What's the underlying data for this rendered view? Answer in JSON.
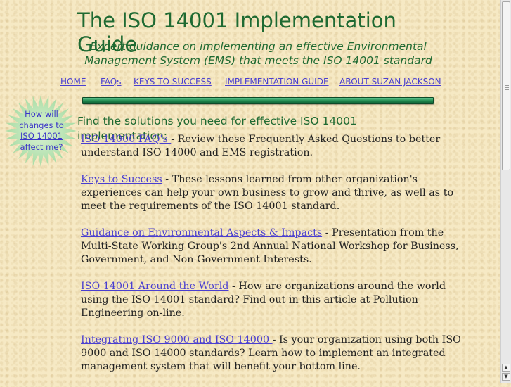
{
  "header": {
    "title": "The ISO 14001 Implementation Guide",
    "subtitle": "Expert guidance on implementing an effective Environmental Management System (EMS) that meets the ISO 14001 standard"
  },
  "nav": {
    "items": [
      {
        "label": "HOME"
      },
      {
        "label": "FAQs "
      },
      {
        "label": "KEYS TO SUCCESS"
      },
      {
        "label": "IMPLEMENTATION GUIDE"
      },
      {
        "label": "ABOUT SUZAN JACKSON"
      }
    ]
  },
  "starburst": {
    "link": "How will changes to ISO 14001 affect me?",
    "color": "#bde6b8"
  },
  "main": {
    "heading": "Find the solutions you need for effective ISO 14001 implementation:",
    "items": [
      {
        "link": "ISO 14000 FAQ's ",
        "text": " - Review these Frequently Asked Questions to better understand ISO 14000 and EMS registration."
      },
      {
        "link": "Keys to Success",
        "text": " - These lessons learned from other organization's experiences can help your own business to grow and thrive, as well as to meet the requirements of the ISO 14001 standard."
      },
      {
        "link": "Guidance on Environmental Aspects & Impacts",
        "text": " - Presentation from the Multi-State Working Group's 2nd Annual National Workshop for Business, Government, and Non-Government Interests."
      },
      {
        "link": "ISO 14001 Around the World",
        "text": " - How are organizations around the world using the ISO 14001 standard?  Find out in this article at Pollution Engineering on-line."
      },
      {
        "link": "Integrating ISO 9000 and ISO 14000 ",
        "text": " - Is your organization using both ISO 9000 and ISO 14000 standards?   Learn how to implement an integrated management system that will benefit your bottom line."
      }
    ]
  },
  "colors": {
    "accent": "#1f6a32",
    "link": "#4a3fd0",
    "background": "#f6e9c4"
  }
}
